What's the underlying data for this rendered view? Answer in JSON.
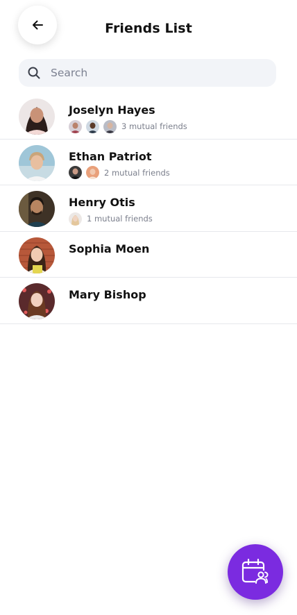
{
  "header": {
    "title": "Friends List",
    "back_icon": "arrow-left-icon"
  },
  "search": {
    "placeholder": "Search",
    "value": "",
    "icon": "search-icon"
  },
  "friends": [
    {
      "name": "Joselyn Hayes",
      "mutual_count": 3,
      "mutual_text": "3 mutual friends"
    },
    {
      "name": "Ethan Patriot",
      "mutual_count": 2,
      "mutual_text": "2 mutual friends"
    },
    {
      "name": "Henry Otis",
      "mutual_count": 1,
      "mutual_text": "1 mutual friends"
    },
    {
      "name": "Sophia Moen",
      "mutual_count": 0,
      "mutual_text": ""
    },
    {
      "name": "Mary Bishop",
      "mutual_count": 0,
      "mutual_text": ""
    }
  ],
  "fab": {
    "icon": "calendar-group-icon"
  },
  "colors": {
    "accent": "#7b2be0",
    "search_bg": "#f2f4f8",
    "divider": "#e6e8ec",
    "muted_text": "#7b7f8c"
  }
}
